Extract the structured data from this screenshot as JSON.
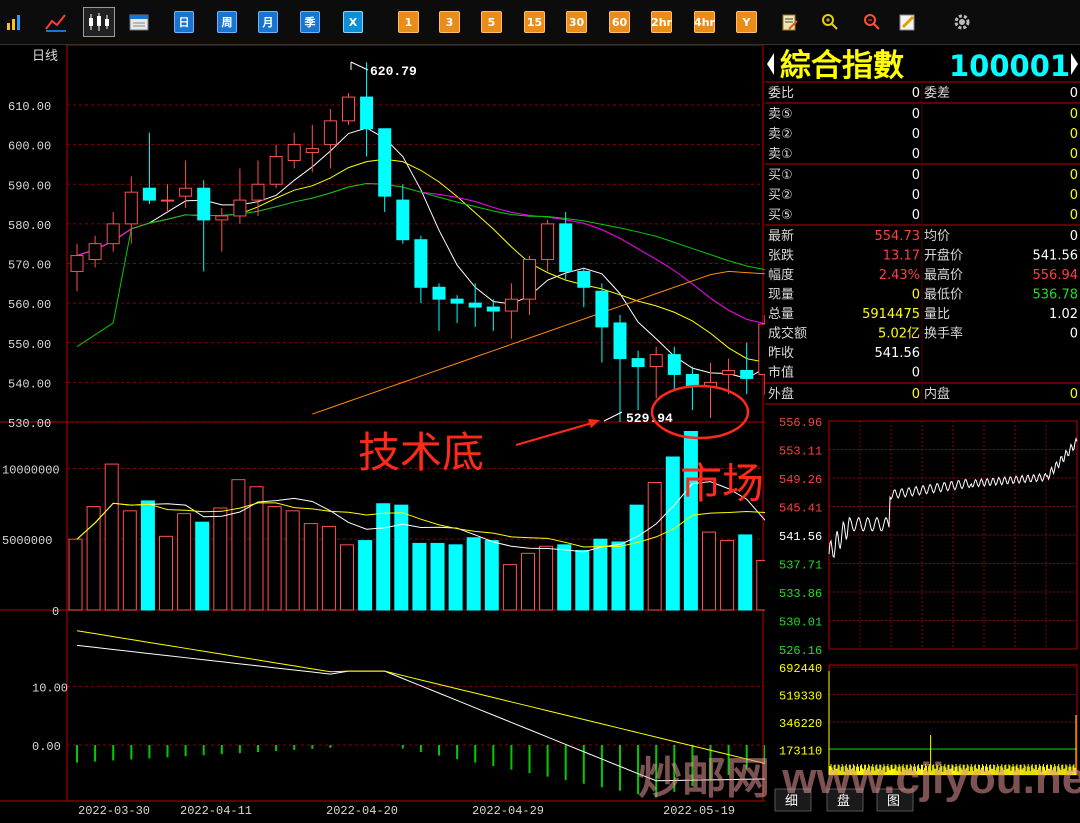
{
  "toolbar": {
    "buttons": [
      {
        "icon": "bar-chart-icon"
      },
      {
        "icon": "line-chart-icon"
      },
      {
        "icon": "candlestick-icon"
      },
      {
        "icon": "calendar-icon"
      },
      {
        "label": "日"
      },
      {
        "label": "周"
      },
      {
        "label": "月"
      },
      {
        "label": "季"
      },
      {
        "label": "X"
      },
      {
        "label": "1"
      },
      {
        "label": "3"
      },
      {
        "label": "5"
      },
      {
        "label": "15"
      },
      {
        "label": "30"
      },
      {
        "label": "60"
      },
      {
        "label": "2hr"
      },
      {
        "label": "4hr"
      },
      {
        "label": "Y"
      },
      {
        "icon": "notepad-icon"
      },
      {
        "icon": "zoom-in-icon"
      },
      {
        "icon": "zoom-out-icon"
      },
      {
        "icon": "pencil-icon"
      },
      {
        "icon": "gear-icon"
      }
    ]
  },
  "main": {
    "period_label": "日线",
    "high_marker": "620.79",
    "low_marker": "529.94",
    "annotation_tech_bottom": "技术底",
    "annotation_market_bottom": "市场底",
    "price_ticks": [
      "610.00",
      "600.00",
      "590.00",
      "580.00",
      "570.00",
      "560.00",
      "550.00",
      "540.00",
      "530.00"
    ],
    "volume_ticks": [
      "10000000",
      "5000000",
      "0"
    ],
    "indicator_ticks": [
      "10.00",
      "0.00"
    ],
    "dates": [
      "2022-03-30",
      "2022-04-11",
      "2022-04-20",
      "2022-04-29",
      "2022-05-19"
    ]
  },
  "chart_data": {
    "type": "candlestick",
    "ylim": [
      530,
      620
    ],
    "high": 620.79,
    "low": 529.94,
    "candles": [
      {
        "o": 568,
        "c": 572,
        "h": 575,
        "l": 563
      },
      {
        "o": 571,
        "c": 575,
        "h": 577,
        "l": 569
      },
      {
        "o": 575,
        "c": 580,
        "h": 583,
        "l": 573
      },
      {
        "o": 580,
        "c": 588,
        "h": 592,
        "l": 575
      },
      {
        "o": 589,
        "c": 586,
        "h": 603,
        "l": 585
      },
      {
        "o": 586,
        "c": 586,
        "h": 590,
        "l": 583
      },
      {
        "o": 587,
        "c": 589,
        "h": 596,
        "l": 584
      },
      {
        "o": 589,
        "c": 581,
        "h": 591,
        "l": 568
      },
      {
        "o": 581,
        "c": 582,
        "h": 584,
        "l": 573
      },
      {
        "o": 582,
        "c": 586,
        "h": 594,
        "l": 580
      },
      {
        "o": 586,
        "c": 590,
        "h": 596,
        "l": 582
      },
      {
        "o": 590,
        "c": 597,
        "h": 600,
        "l": 589
      },
      {
        "o": 596,
        "c": 600,
        "h": 603,
        "l": 594
      },
      {
        "o": 598,
        "c": 599,
        "h": 605,
        "l": 593
      },
      {
        "o": 600,
        "c": 606,
        "h": 609,
        "l": 594
      },
      {
        "o": 606,
        "c": 612,
        "h": 613,
        "l": 605
      },
      {
        "o": 612,
        "c": 604,
        "h": 620.79,
        "l": 597
      },
      {
        "o": 604,
        "c": 587,
        "h": 604,
        "l": 583
      },
      {
        "o": 586,
        "c": 576,
        "h": 590,
        "l": 575
      },
      {
        "o": 576,
        "c": 564,
        "h": 577,
        "l": 560
      },
      {
        "o": 564,
        "c": 561,
        "h": 565,
        "l": 553
      },
      {
        "o": 561,
        "c": 560,
        "h": 562,
        "l": 555
      },
      {
        "o": 560,
        "c": 559,
        "h": 565,
        "l": 554
      },
      {
        "o": 559,
        "c": 558,
        "h": 561,
        "l": 553
      },
      {
        "o": 558,
        "c": 561,
        "h": 565,
        "l": 551
      },
      {
        "o": 561,
        "c": 571,
        "h": 572,
        "l": 557
      },
      {
        "o": 571,
        "c": 580,
        "h": 581,
        "l": 568
      },
      {
        "o": 580,
        "c": 568,
        "h": 583,
        "l": 566
      },
      {
        "o": 568,
        "c": 564,
        "h": 569,
        "l": 559
      },
      {
        "o": 563,
        "c": 554,
        "h": 565,
        "l": 545
      },
      {
        "o": 555,
        "c": 546,
        "h": 557,
        "l": 530
      },
      {
        "o": 546,
        "c": 544,
        "h": 548,
        "l": 533
      },
      {
        "o": 544,
        "c": 547,
        "h": 549,
        "l": 536
      },
      {
        "o": 547,
        "c": 542,
        "h": 549,
        "l": 538
      },
      {
        "o": 542,
        "c": 539,
        "h": 544,
        "l": 533
      },
      {
        "o": 539,
        "c": 540,
        "h": 545,
        "l": 531
      },
      {
        "o": 542,
        "c": 543,
        "h": 546,
        "l": 537
      },
      {
        "o": 543,
        "c": 541,
        "h": 550,
        "l": 537
      },
      {
        "o": 542,
        "c": 554.73,
        "h": 556.94,
        "l": 536.78
      }
    ],
    "volume": [
      5000000,
      7300000,
      10300000,
      7000000,
      7700000,
      5200000,
      6800000,
      6200000,
      7200000,
      9200000,
      8700000,
      7300000,
      7000000,
      6100000,
      5900000,
      4600000,
      4900000,
      7500000,
      7400000,
      4700000,
      4700000,
      4600000,
      5100000,
      4900000,
      3200000,
      4000000,
      4500000,
      4600000,
      4200000,
      5000000,
      4800000,
      7400000,
      9000000,
      10800000,
      12600000,
      5500000,
      4900000,
      5300000,
      3500000,
      5800000
    ],
    "volume_ylim": [
      0,
      12000000
    ],
    "indicator_ylim": [
      -5,
      20
    ]
  },
  "quote": {
    "name": "綜合指數",
    "code": "100001",
    "rows_top": [
      {
        "l1": "委比",
        "v1": "0",
        "l2": "委差",
        "v2": "0"
      }
    ],
    "sell": [
      {
        "l": "卖⑤",
        "p": "0",
        "q": "0"
      },
      {
        "l": "卖②",
        "p": "0",
        "q": "0"
      },
      {
        "l": "卖①",
        "p": "0",
        "q": "0"
      }
    ],
    "buy": [
      {
        "l": "买①",
        "p": "0",
        "q": "0"
      },
      {
        "l": "买②",
        "p": "0",
        "q": "0"
      },
      {
        "l": "买⑤",
        "p": "0",
        "q": "0"
      }
    ],
    "stats": [
      {
        "l1": "最新",
        "v1": "554.73",
        "l2": "均价",
        "v2": "0",
        "c1": "#ff4040",
        "c2": "#ffffff"
      },
      {
        "l1": "张跌",
        "v1": "13.17",
        "l2": "开盘价",
        "v2": "541.56",
        "c1": "#ff4040",
        "c2": "#ffffff"
      },
      {
        "l1": "幅度",
        "v1": "2.43%",
        "l2": "最高价",
        "v2": "556.94",
        "c1": "#ff4040",
        "c2": "#ff4040"
      },
      {
        "l1": "现量",
        "v1": "0",
        "l2": "最低价",
        "v2": "536.78",
        "c1": "#ffff00",
        "c2": "#22dd22"
      },
      {
        "l1": "总量",
        "v1": "5914475",
        "l2": "量比",
        "v2": "1.02",
        "c1": "#ffff00",
        "c2": "#ffffff"
      },
      {
        "l1": "成交额",
        "v1": "5.02亿",
        "l2": "换手率",
        "v2": "0",
        "c1": "#ffff00",
        "c2": "#ffffff"
      },
      {
        "l1": "昨收",
        "v1": "541.56",
        "l2": "",
        "v2": "",
        "c1": "#ffffff",
        "c2": "#ffffff"
      },
      {
        "l1": "市值",
        "v1": "0",
        "l2": "",
        "v2": "",
        "c1": "#ffffff",
        "c2": "#ffffff"
      }
    ],
    "bottom": {
      "l1": "外盘",
      "v1": "0",
      "l2": "内盘",
      "v2": "0"
    },
    "mini_price_ticks": [
      "556.96",
      "553.11",
      "549.26",
      "545.41",
      "541.56",
      "537.71",
      "533.86",
      "530.01",
      "526.16"
    ],
    "mini_volume_ticks": [
      "692440",
      "519330",
      "346220",
      "173110"
    ],
    "tabs": [
      "细",
      "盘",
      "图"
    ]
  },
  "watermark": "炒邮网 www.cjiyou.net",
  "colors": {
    "up": "#ff5050",
    "down": "#00ffff",
    "grid": "#8b0000",
    "axis": "#c00000"
  }
}
